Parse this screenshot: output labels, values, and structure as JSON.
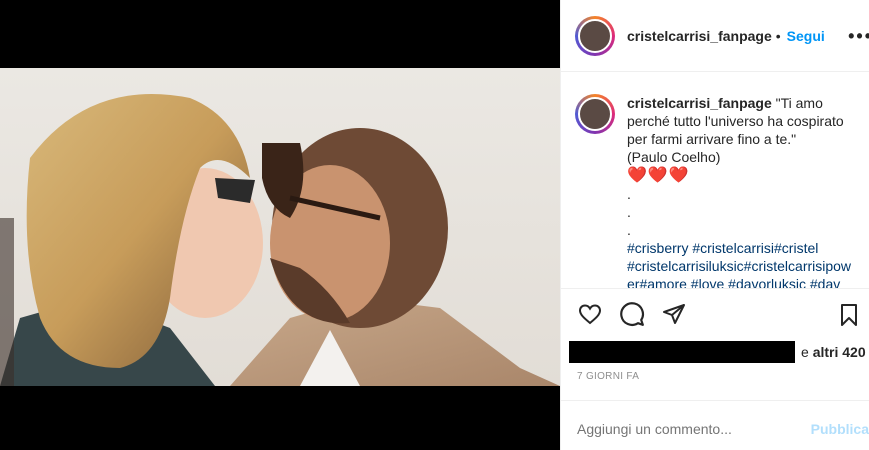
{
  "post": {
    "username": "cristelcarrisi_fanpage",
    "dot": "•",
    "follow_label": "Segui",
    "more_label": "•••"
  },
  "caption": {
    "username": "cristelcarrisi_fanpage",
    "line1": "\"Ti amo perché tutto l'universo ha cospirato per farmi arrivare fino a te.\"",
    "attribution": "(Paulo Coelho)",
    "hearts": "❤️❤️❤️",
    "dots": [
      ".",
      ".",
      "."
    ],
    "hashtags_line1": "#crisberry #cristelcarrisi#cristel",
    "hashtags_line2": "#cristelcarrisiluksic#cristelcarrisipow",
    "hashtags_line3": "er#amore #love #davorluksic #dav"
  },
  "actions": {
    "like_icon": "heart-icon",
    "comment_icon": "comment-icon",
    "share_icon": "share-icon",
    "save_icon": "bookmark-icon"
  },
  "likes": {
    "suffix_e": "e",
    "others": "altri 420"
  },
  "timestamp": "7 GIORNI FA",
  "comment_box": {
    "placeholder": "Aggiungi un commento...",
    "post_label": "Pubblica"
  }
}
